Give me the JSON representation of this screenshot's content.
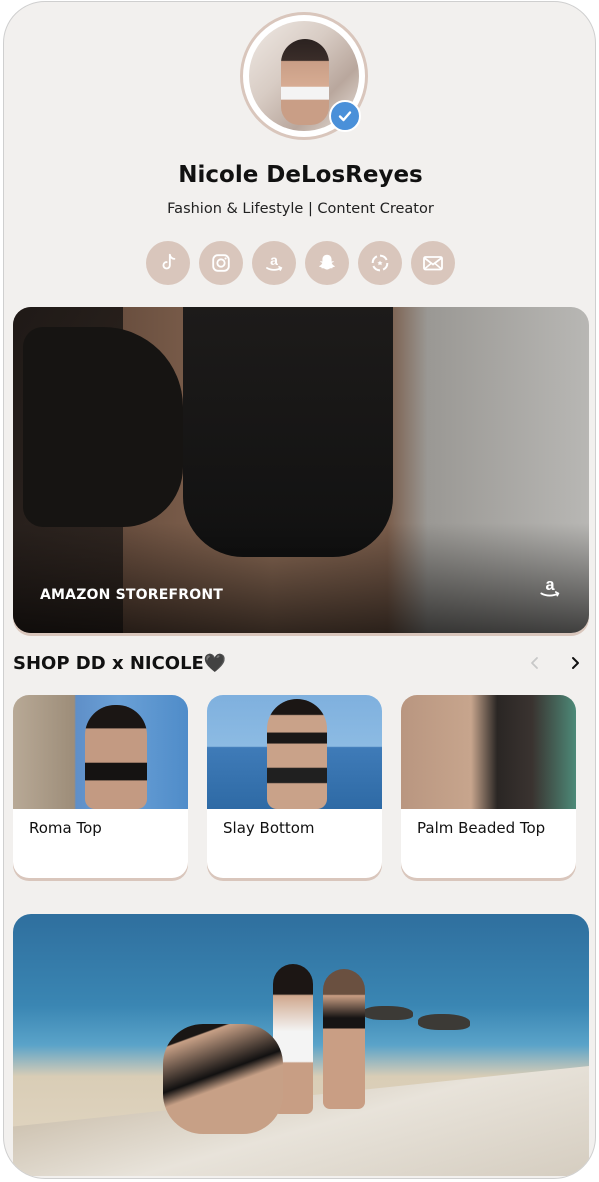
{
  "profile": {
    "name": "Nicole DeLosReyes",
    "bio": "Fashion & Lifestyle | Content Creator",
    "verified": true
  },
  "socials": [
    {
      "name": "tiktok-icon"
    },
    {
      "name": "instagram-icon"
    },
    {
      "name": "amazon-icon"
    },
    {
      "name": "snapchat-icon"
    },
    {
      "name": "ltk-icon"
    },
    {
      "name": "email-icon"
    }
  ],
  "hero": {
    "label": "AMAZON STOREFRONT",
    "icon": "amazon-icon"
  },
  "shop": {
    "title": "SHOP DD x NICOLE🖤",
    "products": [
      {
        "label": "Roma Top"
      },
      {
        "label": "Slay Bottom"
      },
      {
        "label": "Palm Beaded Top"
      }
    ]
  },
  "colors": {
    "background": "#f2f0ee",
    "accent": "#d9c6bc",
    "verified": "#4a90d9"
  }
}
